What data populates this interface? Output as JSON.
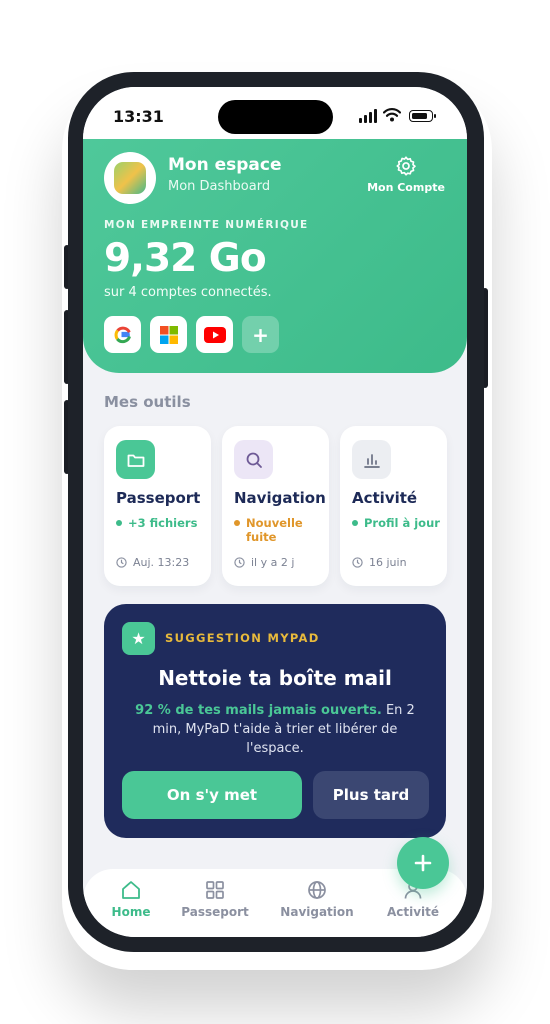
{
  "status_bar": {
    "time": "13:31"
  },
  "header": {
    "title": "Mon espace",
    "subtitle": "Mon Dashboard",
    "account_label": "Mon Compte",
    "footprint_label": "MON EMPREINTE NUMÉRIQUE",
    "footprint_value": "9,32 Go",
    "footprint_sub": "sur 4 comptes connectés.",
    "providers": [
      "google-icon",
      "microsoft-icon",
      "youtube-icon"
    ],
    "add_label": "+"
  },
  "tools": {
    "section_title": "Mes outils",
    "items": [
      {
        "name": "Passeport",
        "icon": "folder-icon",
        "status": "+3 fichiers",
        "status_color": "#3dbb8a",
        "time": "Auj. 13:23"
      },
      {
        "name": "Navigation",
        "icon": "search-icon",
        "status": "Nouvelle fuite",
        "status_color": "#e0962a",
        "time": "il y a 2 j"
      },
      {
        "name": "Activité",
        "icon": "bar-chart-icon",
        "status": "Profil à jour",
        "status_color": "#3dbb8a",
        "time": "16 juin"
      }
    ]
  },
  "suggestion": {
    "tag": "SUGGESTION MYPAD",
    "title": "Nettoie ta boîte mail",
    "highlight": "92 % de tes mails jamais ouverts.",
    "body": " En 2 min, MyPaD t'aide à trier et libérer de l'espace.",
    "primary_button": "On s'y met",
    "secondary_button": "Plus tard"
  },
  "tabbar": {
    "items": [
      {
        "label": "Home",
        "icon": "home-icon",
        "active": true
      },
      {
        "label": "Passeport",
        "icon": "grid-icon",
        "active": false
      },
      {
        "label": "Navigation",
        "icon": "globe-icon",
        "active": false
      },
      {
        "label": "Activité",
        "icon": "user-icon",
        "active": false
      }
    ]
  },
  "colors": {
    "accent": "#4ac796",
    "navy": "#1f2b5c",
    "warning": "#e0962a",
    "background": "#f1f2f6"
  }
}
